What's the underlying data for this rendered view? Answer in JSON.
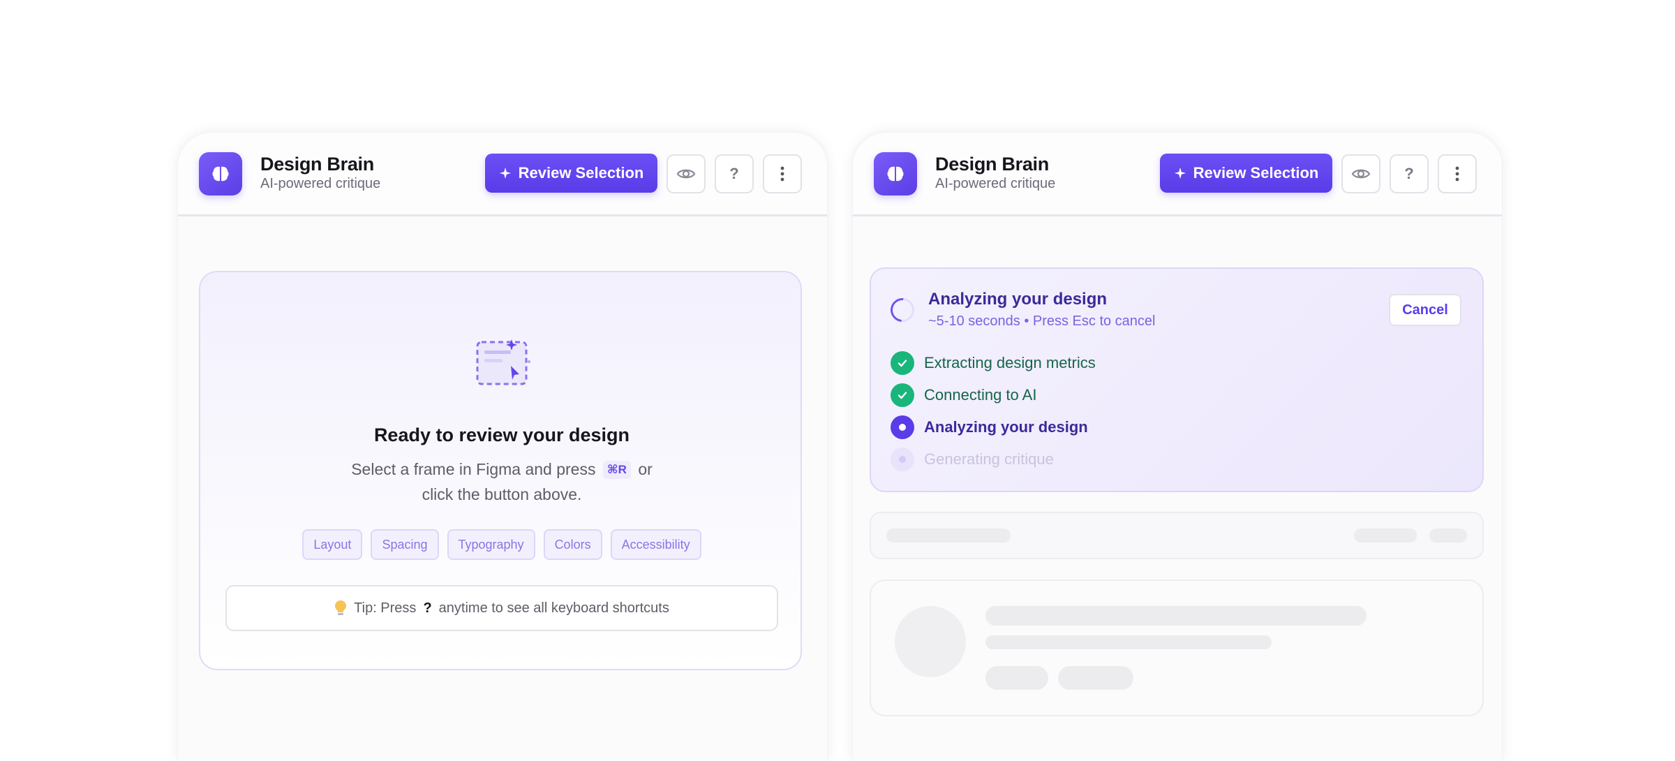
{
  "panels": [
    {
      "app_title": "Design Brain",
      "app_subtitle": "AI-powered critique",
      "review_button": "Review Selection",
      "help_icon_label": "?"
    },
    {
      "app_title": "Design Brain",
      "app_subtitle": "AI-powered critique",
      "review_button": "Review Selection",
      "help_icon_label": "?"
    }
  ],
  "empty_state": {
    "title": "Ready to review your design",
    "desc_before": "Select a frame in Figma and press",
    "shortcut": "⌘R",
    "desc_after": "or click the button above.",
    "chips": [
      "Layout",
      "Spacing",
      "Typography",
      "Colors",
      "Accessibility"
    ],
    "tip_prefix": "Tip: Press",
    "tip_key": "?",
    "tip_suffix": "anytime to see all keyboard shortcuts"
  },
  "analysis": {
    "title": "Analyzing your design",
    "subtitle": "~5-10 seconds • Press Esc to cancel",
    "cancel_label": "Cancel",
    "steps": [
      {
        "label": "Extracting design metrics",
        "status": "done"
      },
      {
        "label": "Connecting to AI",
        "status": "done"
      },
      {
        "label": "Analyzing your design",
        "status": "active"
      },
      {
        "label": "Generating critique",
        "status": "pending"
      }
    ]
  },
  "colors": {
    "accent": "#5a3ce8",
    "success": "#19b57a"
  },
  "icons": {
    "logo": "brain-icon",
    "review_button": "sparkle-icon",
    "visibility": "eye-icon",
    "help": "question-icon",
    "menu": "more-vertical-icon",
    "tip": "lightbulb-icon"
  }
}
